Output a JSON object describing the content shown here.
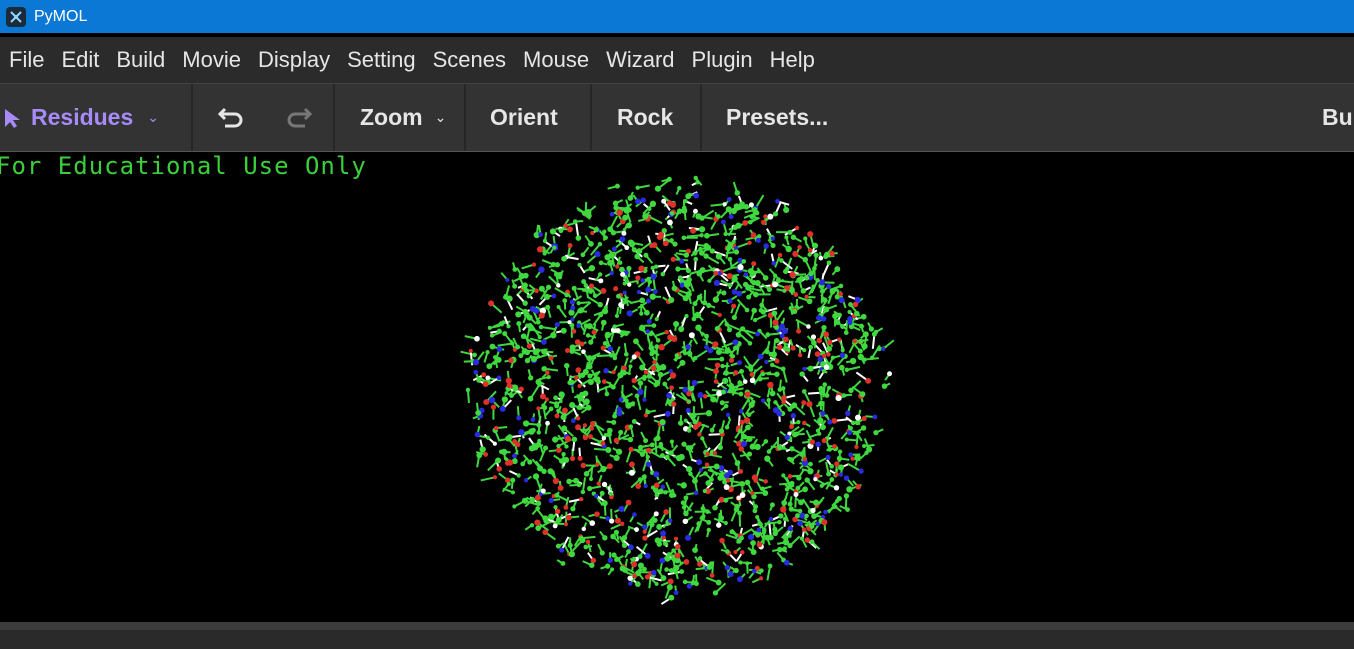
{
  "window": {
    "title": "PyMOL"
  },
  "menu": [
    "File",
    "Edit",
    "Build",
    "Movie",
    "Display",
    "Setting",
    "Scenes",
    "Mouse",
    "Wizard",
    "Plugin",
    "Help"
  ],
  "toolbar": {
    "selection_mode": "Residues",
    "zoom": "Zoom",
    "orient": "Orient",
    "rock": "Rock",
    "presets": "Presets...",
    "builder_partial": "Bu"
  },
  "viewport": {
    "watermark": "For Educational Use Only",
    "background_color": "#000000",
    "atom_colors": {
      "carbon": "#3fd93f",
      "oxygen": "#e0302a",
      "nitrogen": "#2a2ae0",
      "hydrogen": "#ffffff"
    }
  }
}
